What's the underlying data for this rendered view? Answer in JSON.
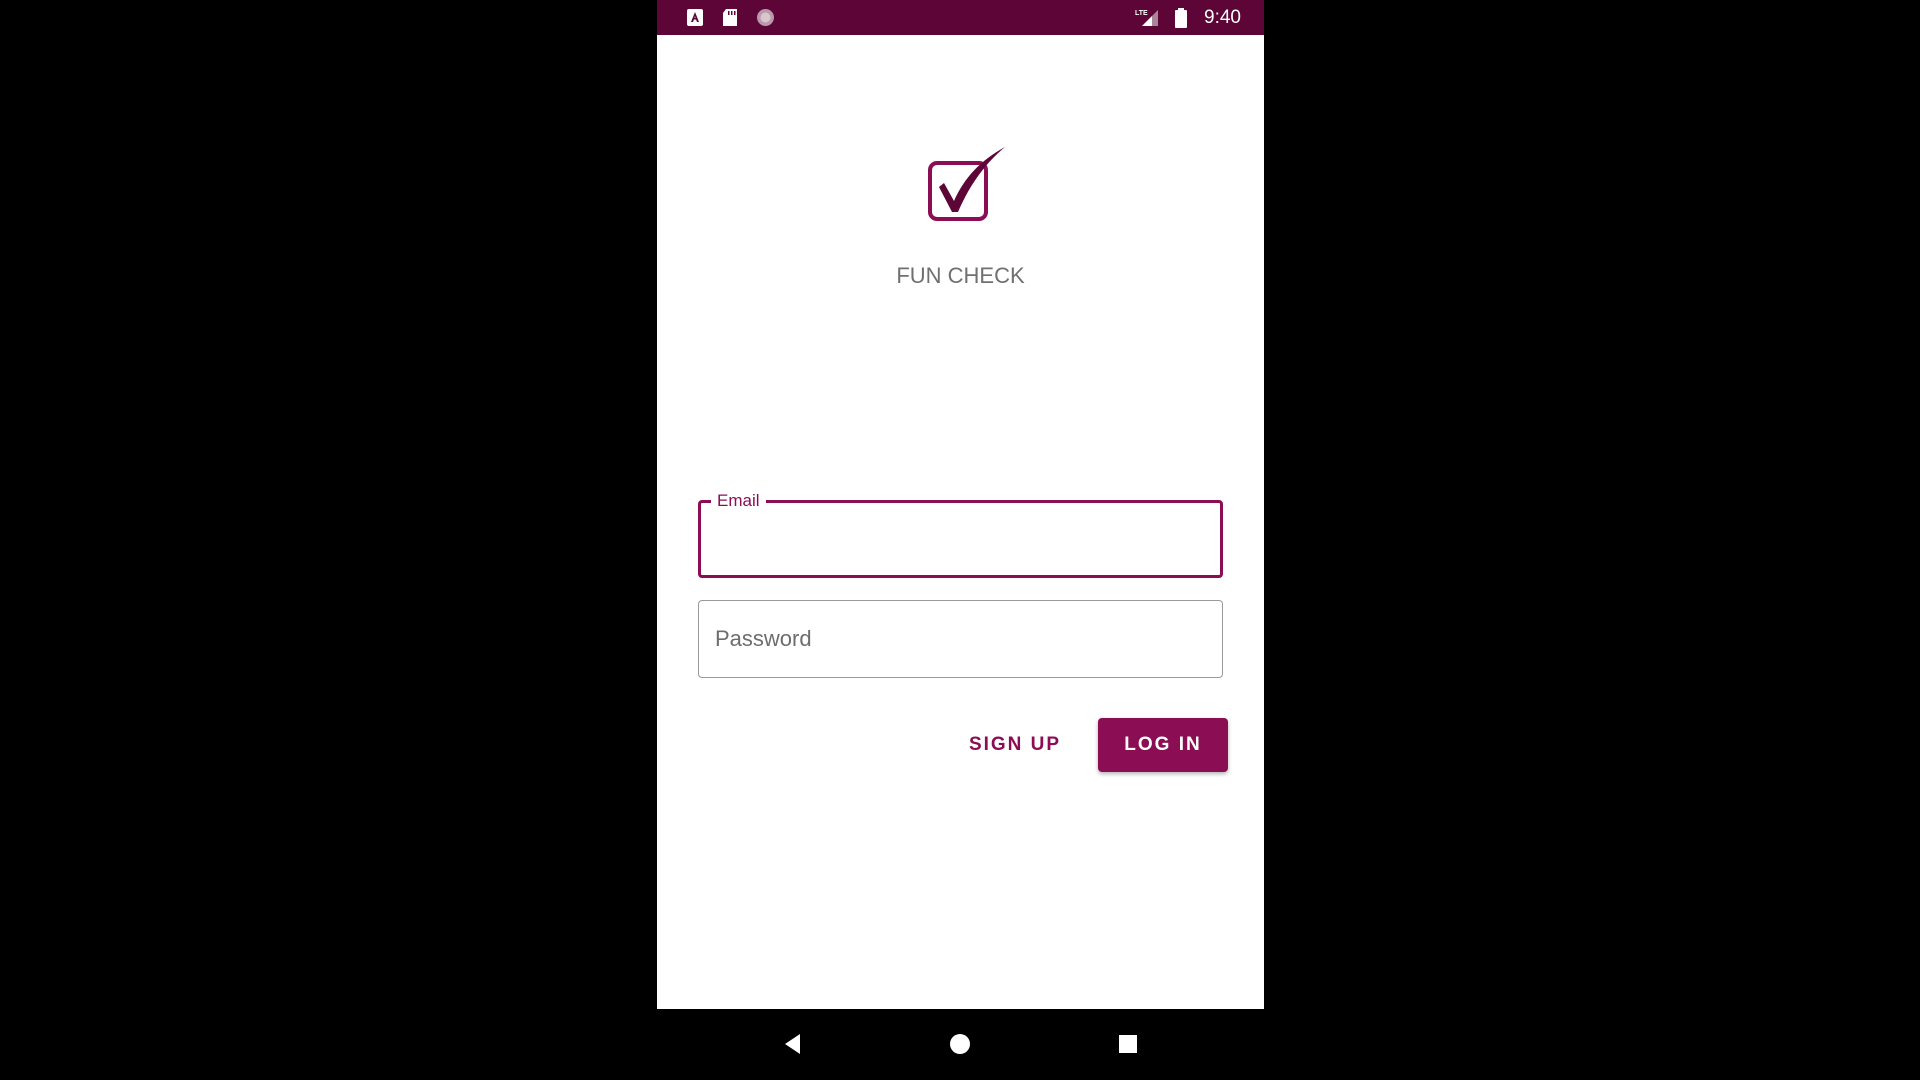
{
  "status_bar": {
    "time": "9:40",
    "network": "LTE",
    "icons": [
      "font-a-icon",
      "sd-card-icon",
      "circle-loader-icon",
      "lte-signal-icon",
      "battery-icon"
    ]
  },
  "app": {
    "title": "FUN CHECK",
    "logo": "checkbox-check-logo-icon"
  },
  "form": {
    "email_label": "Email",
    "email_value": "",
    "password_placeholder": "Password",
    "password_value": ""
  },
  "actions": {
    "signup_label": "SIGN UP",
    "login_label": "LOG IN"
  },
  "nav": {
    "icons": [
      "back-triangle-icon",
      "home-circle-icon",
      "recents-square-icon"
    ]
  },
  "colors": {
    "accent": "#8b0e55",
    "status_bar": "#5c0536",
    "title_text": "#707070",
    "field_border_inactive": "#9a9a9a"
  }
}
